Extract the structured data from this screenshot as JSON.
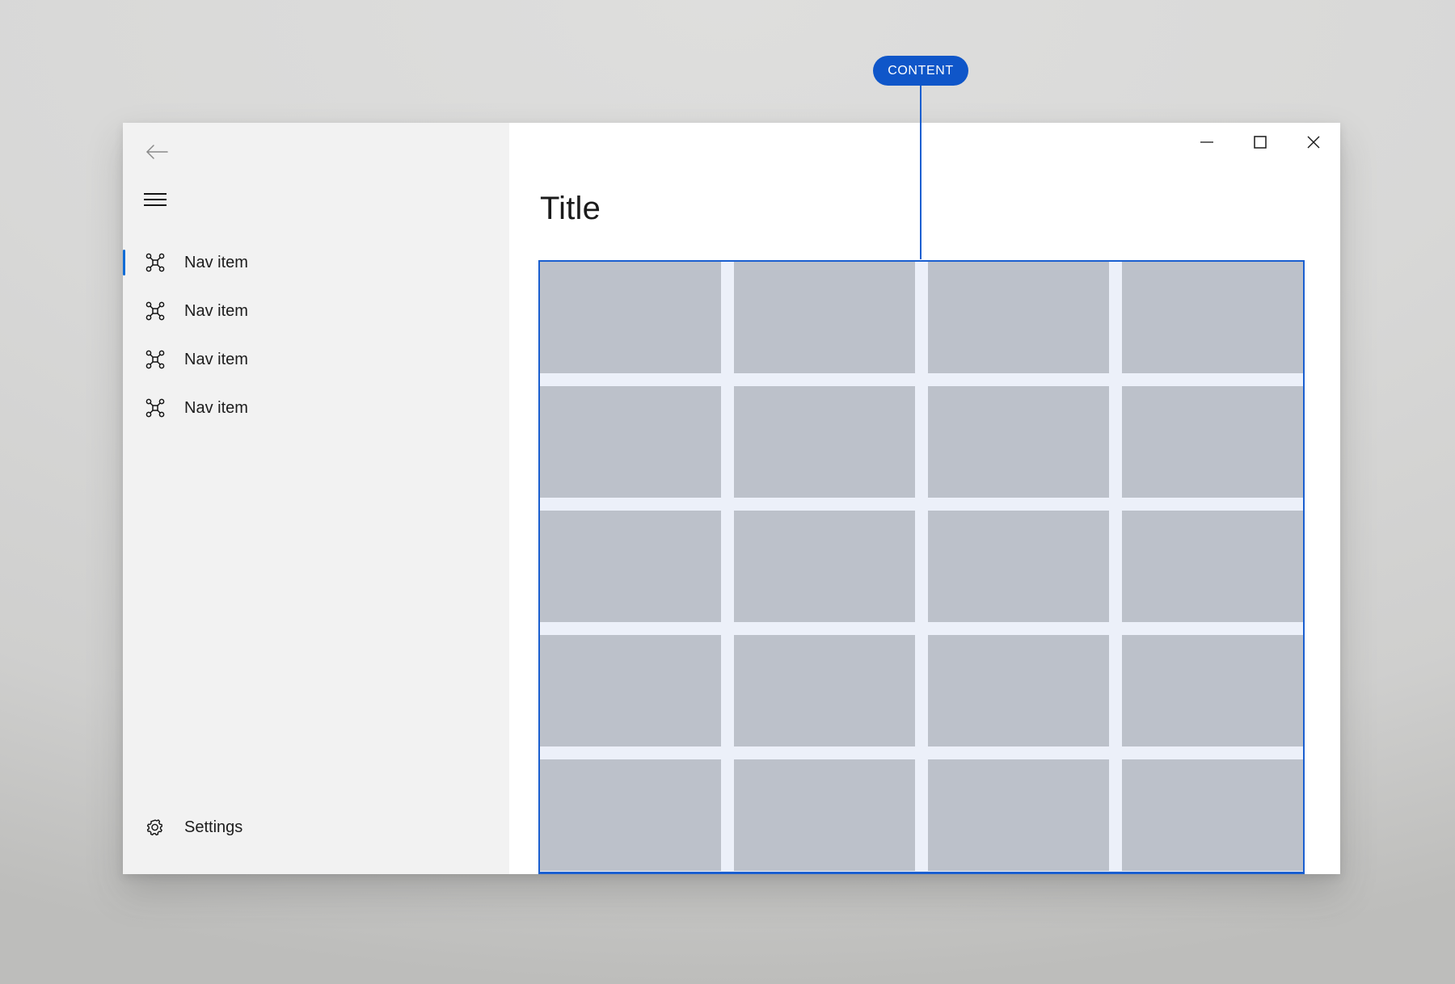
{
  "annotation": {
    "badge_label": "CONTENT",
    "badge_color": "#0f56c9",
    "leader_color": "#1a5fd0"
  },
  "window": {
    "titlebar": {
      "minimize_label": "─",
      "maximize_label": "☐",
      "close_label": "✕",
      "minimize_name": "minimize",
      "maximize_name": "maximize",
      "close_name": "close"
    }
  },
  "nav_pane": {
    "back_button_label": "Back",
    "menu_button_label": "Menu",
    "items": [
      {
        "label": "Nav item",
        "icon": "connector-icon",
        "selected": true
      },
      {
        "label": "Nav item",
        "icon": "connector-icon",
        "selected": false
      },
      {
        "label": "Nav item",
        "icon": "connector-icon",
        "selected": false
      },
      {
        "label": "Nav item",
        "icon": "connector-icon",
        "selected": false
      }
    ],
    "settings": {
      "label": "Settings",
      "icon": "gear-icon"
    },
    "selection_indicator_color": "#0f6cd6",
    "background_color": "#f2f2f2"
  },
  "content": {
    "title": "Title",
    "region_border_color": "#1a5fd0",
    "region_background_color": "#ecf0f9",
    "tile_color": "#bcc1ca",
    "grid_columns": 4,
    "grid_rows": 5,
    "tiles": [
      {
        "id": "tile-1"
      },
      {
        "id": "tile-2"
      },
      {
        "id": "tile-3"
      },
      {
        "id": "tile-4"
      },
      {
        "id": "tile-5"
      },
      {
        "id": "tile-6"
      },
      {
        "id": "tile-7"
      },
      {
        "id": "tile-8"
      },
      {
        "id": "tile-9"
      },
      {
        "id": "tile-10"
      },
      {
        "id": "tile-11"
      },
      {
        "id": "tile-12"
      },
      {
        "id": "tile-13"
      },
      {
        "id": "tile-14"
      },
      {
        "id": "tile-15"
      },
      {
        "id": "tile-16"
      },
      {
        "id": "tile-17"
      },
      {
        "id": "tile-18"
      },
      {
        "id": "tile-19"
      },
      {
        "id": "tile-20"
      }
    ]
  }
}
